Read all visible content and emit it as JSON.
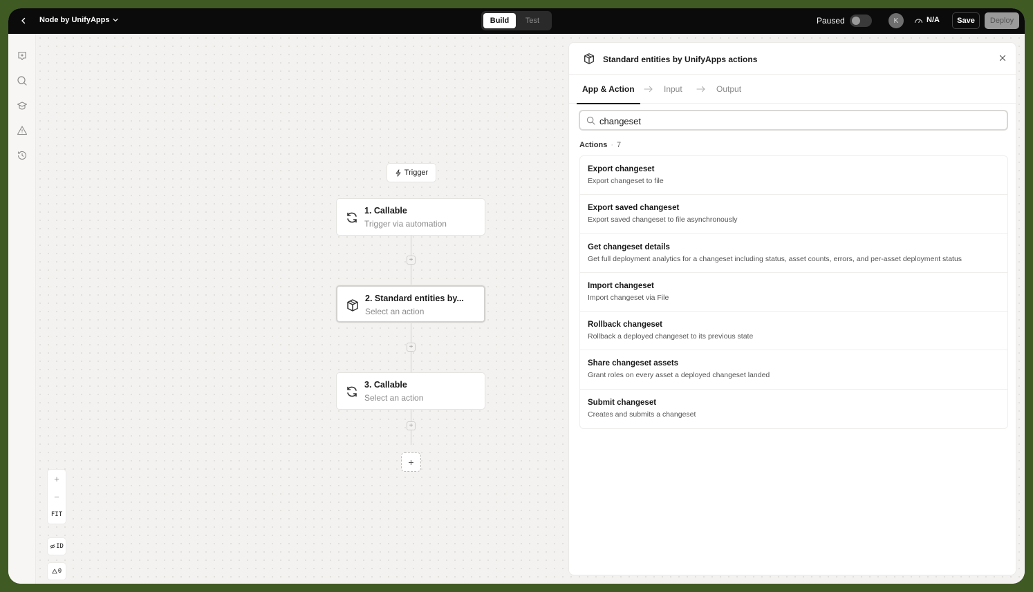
{
  "topbar": {
    "app_name": "Node by UnifyApps",
    "tabs": [
      {
        "label": "Build",
        "active": true
      },
      {
        "label": "Test",
        "active": false
      }
    ],
    "paused_label": "Paused",
    "paused_on": false,
    "avatar_initial": "K",
    "metric": "N/A",
    "save_label": "Save",
    "deploy_label": "Deploy"
  },
  "rail": {
    "icons": [
      "sparkle-badge-icon",
      "search-icon",
      "graduation-cap-icon",
      "warning-icon",
      "history-icon"
    ]
  },
  "canvas": {
    "trigger_label": "Trigger",
    "nodes": [
      {
        "title": "1. Callable",
        "subtitle": "Trigger via automation",
        "icon": "refresh-icon"
      },
      {
        "title": "2. Standard entities by...",
        "subtitle": "Select an action",
        "icon": "cube-icon",
        "selected": true
      },
      {
        "title": "3. Callable",
        "subtitle": "Select an action",
        "icon": "refresh-icon"
      }
    ],
    "add_symbol": "+",
    "zoom": {
      "in": "+",
      "out": "−",
      "fit": "FIT"
    },
    "id_label": "ID",
    "warnings_count": "0"
  },
  "panel": {
    "title": "Standard entities by UnifyApps actions",
    "steps": [
      {
        "label": "App & Action",
        "active": true
      },
      {
        "label": "Input",
        "active": false
      },
      {
        "label": "Output",
        "active": false
      }
    ],
    "search_value": "changeset",
    "actions_label": "Actions",
    "actions_count": "7",
    "actions": [
      {
        "title": "Export changeset",
        "desc": "Export changeset to file"
      },
      {
        "title": "Export saved changeset",
        "desc": "Export saved changeset to file asynchronously"
      },
      {
        "title": "Get changeset details",
        "desc": "Get full deployment analytics for a changeset including status, asset counts, errors, and per-asset deployment status"
      },
      {
        "title": "Import changeset",
        "desc": "Import changeset via File"
      },
      {
        "title": "Rollback changeset",
        "desc": "Rollback a deployed changeset to its previous state"
      },
      {
        "title": "Share changeset assets",
        "desc": "Grant roles on every asset a deployed changeset landed"
      },
      {
        "title": "Submit changeset",
        "desc": "Creates and submits a changeset"
      }
    ]
  }
}
